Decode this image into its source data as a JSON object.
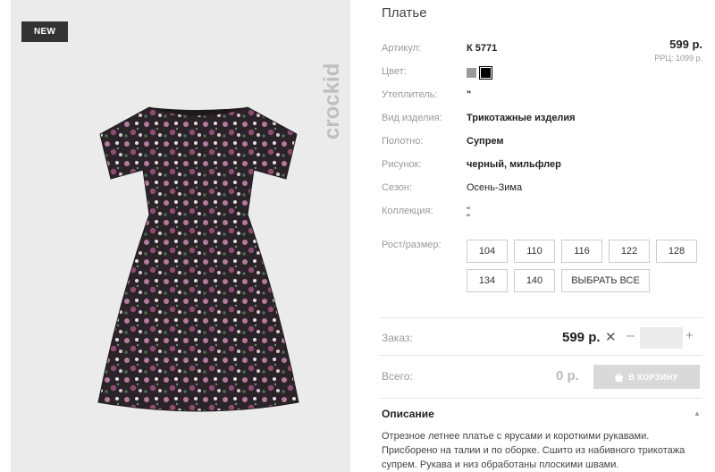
{
  "badge": "NEW",
  "brand": "crockid",
  "product": {
    "title": "Платье",
    "price": "599 р.",
    "rrc": "РРЦ: 1099 р."
  },
  "attributes": {
    "article": {
      "label": "Артикул:",
      "value": "К 5771"
    },
    "color": {
      "label": "Цвет:",
      "swatches": [
        "#9a9a9a",
        "#000000"
      ]
    },
    "insulation": {
      "label": "Утеплитель:",
      "value": "\""
    },
    "type": {
      "label": "Вид изделия:",
      "value": "Трикотажные изделия"
    },
    "fabric": {
      "label": "Полотно:",
      "value": "Супрем"
    },
    "pattern": {
      "label": "Рисунок:",
      "value": "черный, мильфлер"
    },
    "season": {
      "label": "Сезон:",
      "value": "Осень-Зима"
    },
    "collection": {
      "label": "Коллекция:",
      "value": "\"",
      "value2": "\""
    }
  },
  "sizes": {
    "label": "Рост/размер:",
    "items": [
      "104",
      "110",
      "116",
      "122",
      "128",
      "134",
      "140"
    ],
    "select_all": "ВЫБРАТЬ ВСЕ"
  },
  "order": {
    "label": "Заказ:",
    "price": "599 р.",
    "remove": "✕",
    "minus": "–",
    "plus": "+",
    "quantity": ""
  },
  "total": {
    "label": "Всего:",
    "value": "0 р.",
    "cart_button": "В КОРЗИНУ"
  },
  "description": {
    "title": "Описание",
    "text": "Отрезное летнее платье с ярусами и короткими рукавами. Присборено на талии и по оборке. Сшито из набивного трикотажа супрем. Рукава и низ обработаны плоскими швами."
  }
}
